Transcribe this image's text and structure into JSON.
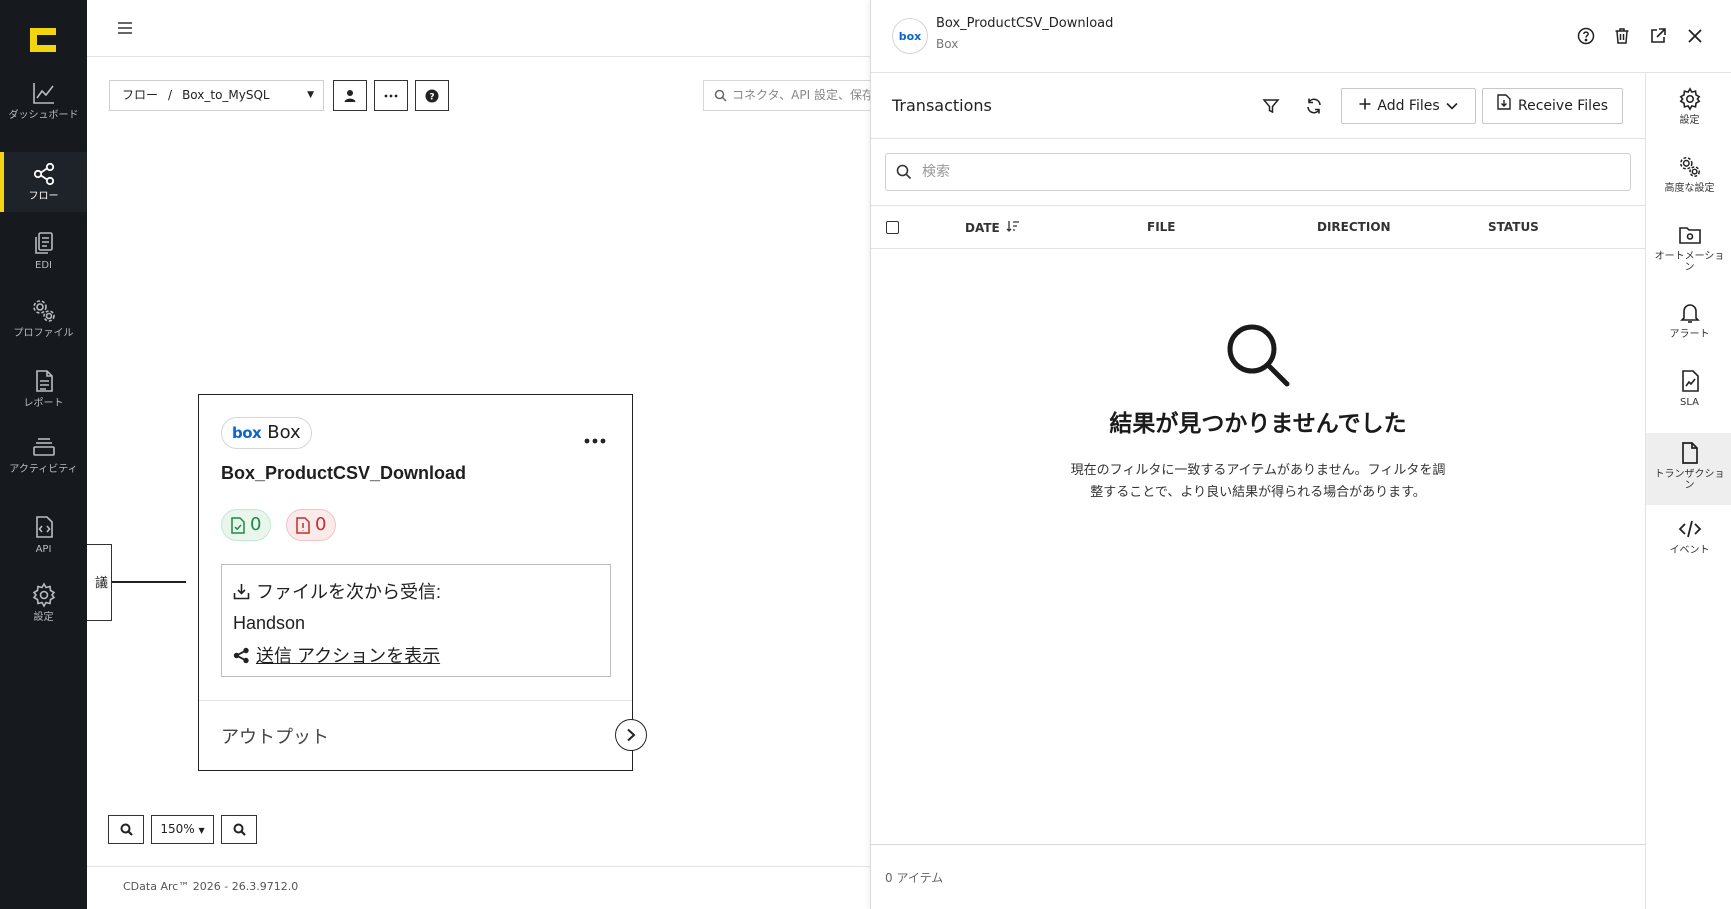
{
  "sidebar": {
    "items": [
      {
        "label": "ダッシュボード",
        "icon": "chart-line-icon"
      },
      {
        "label": "フロー",
        "icon": "flow-share-icon",
        "active": true
      },
      {
        "label": "EDI",
        "icon": "documents-icon"
      },
      {
        "label": "プロファイル",
        "icon": "gears-icon"
      },
      {
        "label": "レポート",
        "icon": "report-icon"
      },
      {
        "label": "アクティビティ",
        "icon": "activity-icon"
      },
      {
        "label": "API",
        "icon": "api-file-icon"
      },
      {
        "label": "設定",
        "icon": "gear-icon"
      }
    ],
    "accent_color": "#f2d40f"
  },
  "canvas": {
    "breadcrumb": {
      "root": "フロー",
      "separator": "/",
      "flow": "Box_to_MySQL"
    },
    "search_placeholder": "コネクタ、API 設定、保存",
    "zoom_level": "150%",
    "version": "CData Arc™ 2026 - 26.3.9712.0",
    "card": {
      "badge_logo": "box",
      "badge_label": "Box",
      "title": "Box_ProductCSV_Download",
      "success_count": "0",
      "error_count": "0",
      "receive_label": "ファイルを次から受信:",
      "receive_source": "Handson",
      "send_action_link": "送信 アクションを表示",
      "output_label": "アウトプット"
    },
    "stub_label": "議"
  },
  "panel": {
    "avatar": "box",
    "title": "Box_ProductCSV_Download",
    "subtitle": "Box",
    "transactions_title": "Transactions",
    "add_files_label": "Add Files",
    "receive_files_label": "Receive Files",
    "search_placeholder": "検索",
    "columns": {
      "date": "DATE",
      "file": "FILE",
      "direction": "DIRECTION",
      "status": "STATUS"
    },
    "empty_title": "結果が見つかりませんでした",
    "empty_desc": "現在のフィルタに一致するアイテムがありません。フィルタを調整することで、より良い結果が得られる場合があります。",
    "item_count": "0 アイテム"
  },
  "rail": {
    "items": [
      {
        "label": "設定"
      },
      {
        "label": "高度な設定"
      },
      {
        "label": "オートメーション"
      },
      {
        "label": "アラート"
      },
      {
        "label": "SLA"
      },
      {
        "label": "トランザクション",
        "active": true
      },
      {
        "label": "イベント"
      }
    ]
  }
}
